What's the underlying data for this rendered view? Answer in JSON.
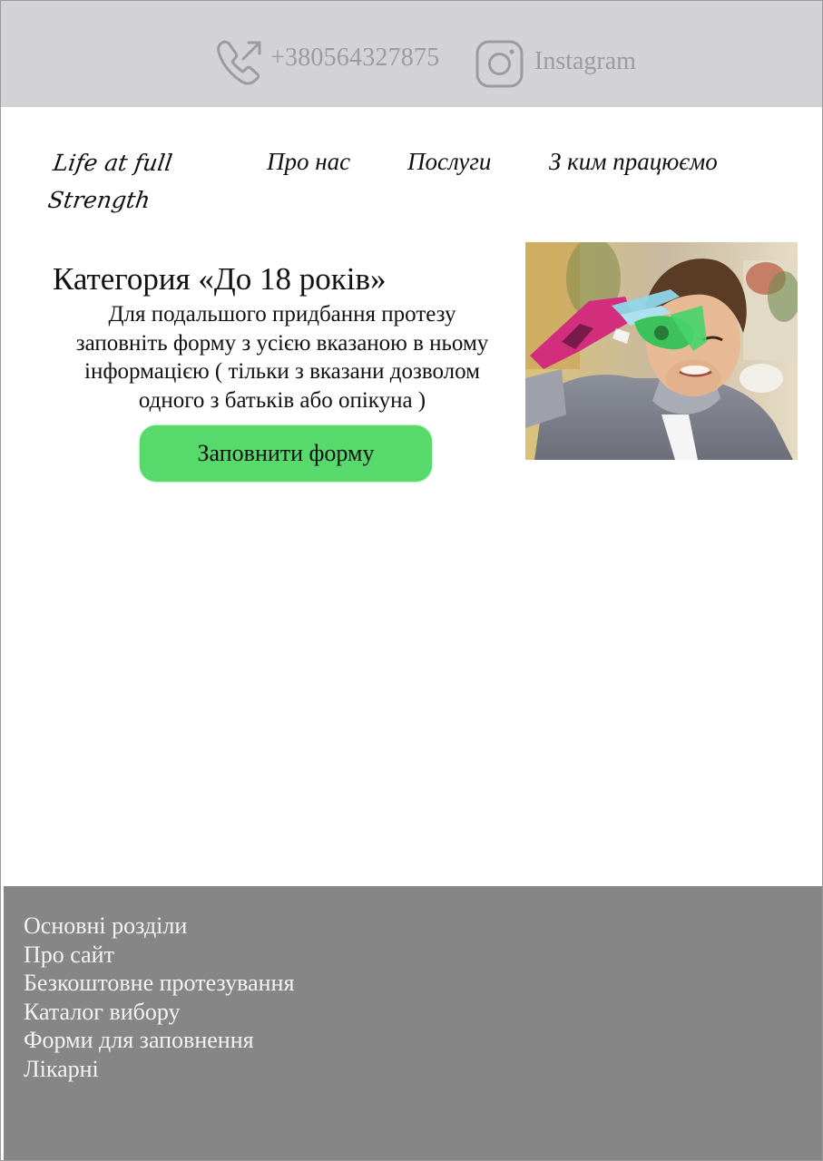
{
  "topbar": {
    "phone": "+380564327875",
    "instagram_label": "Instagram",
    "icons": [
      "phone-outgoing-icon",
      "instagram-icon"
    ]
  },
  "header": {
    "logo_line1": "Life at full",
    "logo_line2": "Strength",
    "nav": [
      {
        "label": "Про нас"
      },
      {
        "label": "Послуги"
      },
      {
        "label": "З ким працюємо"
      }
    ]
  },
  "main": {
    "title": "Категория «До 18 років»",
    "description_lines": [
      "Для подальшого придбання протезу",
      "заповніть форму з усією вказаною в ньому",
      "інформацією ( тільки з вказани дозволом",
      "одного з батьків або опікуна )"
    ],
    "button_label": "Заповнити форму"
  },
  "footer": {
    "links": [
      "Основні розділи",
      "Про сайт",
      "Безкоштовне протезування",
      "Каталог вибору",
      "Форми для заповнення",
      "Лікарні"
    ]
  },
  "colors": {
    "topbar_bg": "#d3d3d6",
    "topbar_text": "#9b9ba0",
    "button_bg": "#58d96b",
    "footer_bg": "#868686",
    "footer_text": "#f3f3f3"
  }
}
